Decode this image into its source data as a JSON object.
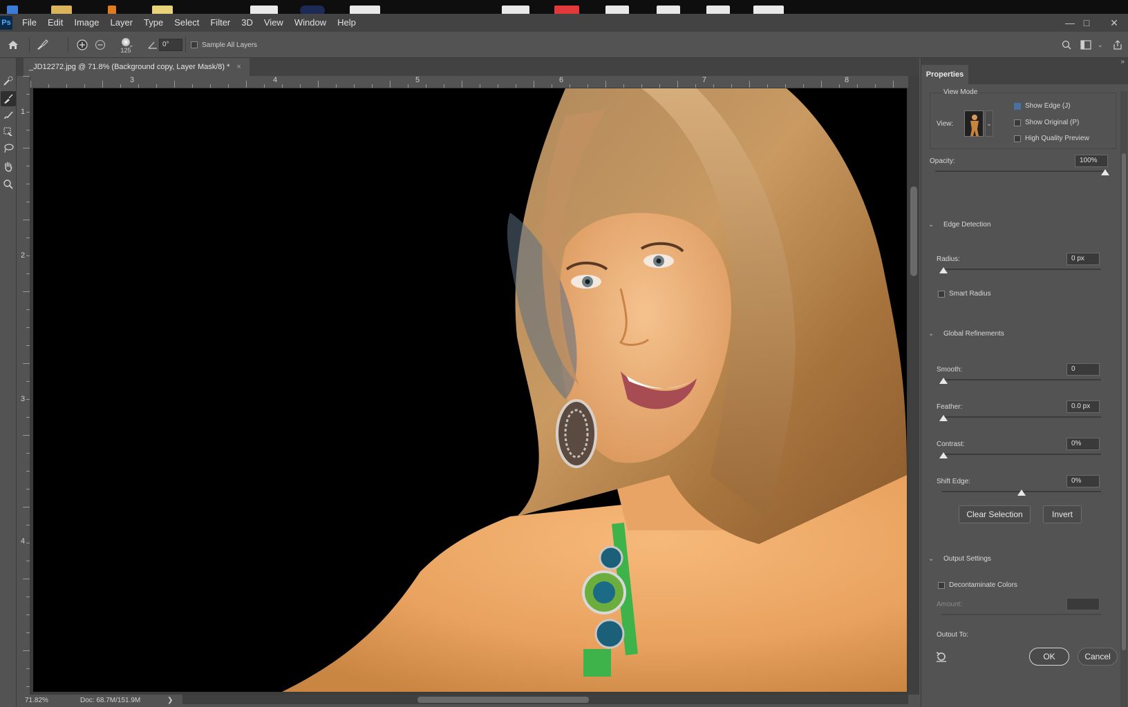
{
  "menu": {
    "items": [
      "File",
      "Edit",
      "Image",
      "Layer",
      "Type",
      "Select",
      "Filter",
      "3D",
      "View",
      "Window",
      "Help"
    ]
  },
  "options_bar": {
    "brush_size": "125",
    "angle": "0°",
    "sample_all_layers": "Sample All Layers"
  },
  "document": {
    "tab_title": "_JD12272.jpg @ 71.8% (Background copy, Layer Mask/8) *",
    "close": "×"
  },
  "rulers": {
    "top": [
      "3",
      "4",
      "5",
      "6",
      "7",
      "8"
    ],
    "left": [
      "1",
      "2",
      "3",
      "4"
    ]
  },
  "status": {
    "zoom": "71.82%",
    "doc": "Doc: 68.7M/151.9M",
    "arrow": "❯"
  },
  "panel": {
    "tab": "Properties",
    "view_mode": "View Mode",
    "view_label": "View:",
    "show_edge": "Show Edge (J)",
    "show_original": "Show Original (P)",
    "high_quality": "High Quality Preview",
    "opacity_label": "Opacity:",
    "opacity_value": "100%",
    "opacity_level": 100,
    "edge_detection": "Edge Detection",
    "radius_label": "Radius:",
    "radius_value": "0 px",
    "smart_radius": "Smart Radius",
    "global_refinements": "Global Refinements",
    "smooth_label": "Smooth:",
    "smooth_value": "0",
    "feather_label": "Feather:",
    "feather_value": "0.0 px",
    "contrast_label": "Contrast:",
    "contrast_value": "0%",
    "shift_label": "Shift Edge:",
    "shift_value": "0%",
    "clear_selection": "Clear Selection",
    "invert": "Invert",
    "output_settings": "Output Settings",
    "decontaminate": "Decontaminate Colors",
    "amount_label": "Amount:",
    "output_to": "Output To:",
    "ok": "OK",
    "cancel": "Cancel"
  },
  "colors": {
    "accent": "#4a90e2",
    "panel_bg": "#535353",
    "canvas_bg": "#000000"
  }
}
